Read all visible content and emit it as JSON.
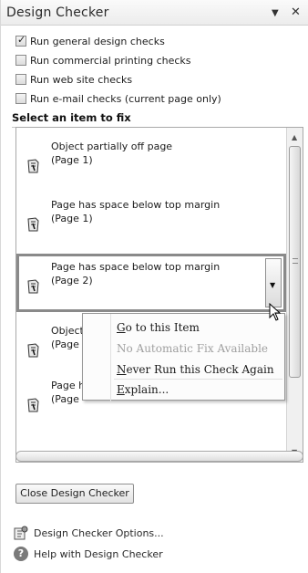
{
  "pane": {
    "title": "Design Checker",
    "dropdown_glyph": "▼",
    "close_glyph": "✕"
  },
  "checks": [
    {
      "label": "Run general design checks",
      "checked": true
    },
    {
      "label": "Run commercial printing checks",
      "checked": false
    },
    {
      "label": "Run web site checks",
      "checked": false
    },
    {
      "label": "Run e-mail checks (current page only)",
      "checked": false
    }
  ],
  "list_heading": "Select an item to fix",
  "items": [
    {
      "line1": "Object partially off page",
      "line2": "(Page 1)",
      "icon": "page-warning-icon"
    },
    {
      "line1": "Page has space below top margin",
      "line2": "(Page 1)",
      "icon": "page-warning-icon"
    },
    {
      "line1": "Page has space below top margin",
      "line2": "(Page 2)",
      "icon": "page-warning-icon",
      "selected": true
    },
    {
      "line1": "Object",
      "line2": "(Page",
      "icon": "page-warning-icon"
    },
    {
      "line1": "Page h",
      "line2": "(Page",
      "icon": "page-warning-icon"
    }
  ],
  "context_menu": [
    {
      "label": "Go to this Item",
      "enabled": true
    },
    {
      "label": "No Automatic Fix Available",
      "enabled": false
    },
    {
      "label": "Never Run this Check Again",
      "enabled": true
    },
    {
      "label": "Explain...",
      "enabled": true
    }
  ],
  "close_button": "Close Design Checker",
  "options_link": "Design Checker Options...",
  "help_link": "Help with Design Checker",
  "help_glyph": "?",
  "colors": {
    "selection_border": "#8a8a8a",
    "disabled_text": "#a0a0a0"
  }
}
